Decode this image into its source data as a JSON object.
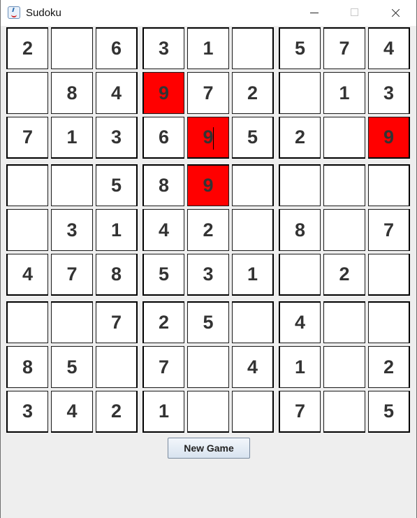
{
  "window": {
    "title": "Sudoku"
  },
  "board": {
    "rows": [
      [
        "2",
        "",
        "6",
        "3",
        "1",
        "",
        "5",
        "7",
        "4"
      ],
      [
        "",
        "8",
        "4",
        "9",
        "7",
        "2",
        "",
        "1",
        "3"
      ],
      [
        "7",
        "1",
        "3",
        "6",
        "9",
        "5",
        "2",
        "",
        "9"
      ],
      [
        "",
        "",
        "5",
        "8",
        "9",
        "",
        "",
        "",
        ""
      ],
      [
        "",
        "3",
        "1",
        "4",
        "2",
        "",
        "8",
        "",
        "7"
      ],
      [
        "4",
        "7",
        "8",
        "5",
        "3",
        "1",
        "",
        "2",
        ""
      ],
      [
        "",
        "",
        "7",
        "2",
        "5",
        "",
        "4",
        "",
        ""
      ],
      [
        "8",
        "5",
        "",
        "7",
        "",
        "4",
        "1",
        "",
        "2"
      ],
      [
        "3",
        "4",
        "2",
        "1",
        "",
        "",
        "7",
        "",
        "5"
      ]
    ],
    "conflict_cells": [
      [
        1,
        3
      ],
      [
        2,
        4
      ],
      [
        2,
        8
      ],
      [
        3,
        4
      ]
    ],
    "active_cell": [
      2,
      4
    ],
    "conflict_color": "#ff0000"
  },
  "controls": {
    "new_game_label": "New Game"
  }
}
